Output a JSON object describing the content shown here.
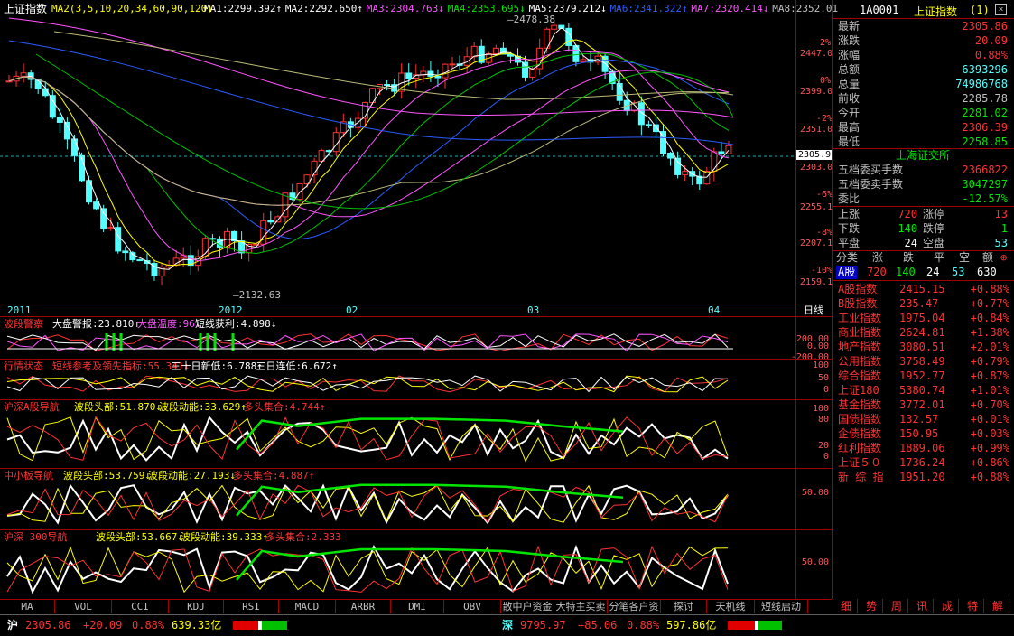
{
  "main": {
    "title": "上证指数",
    "ma_params": "MA2(3,5,10,20,34,60,90,120)",
    "ma_values": [
      {
        "label": "MA1:2299.392↑",
        "color": "#ffffff"
      },
      {
        "label": "MA2:2292.650↑",
        "color": "#ffffff"
      },
      {
        "label": "MA3:2304.763↓",
        "color": "#ff54ff"
      },
      {
        "label": "MA4:2353.695↓",
        "color": "#00e600"
      },
      {
        "label": "MA5:2379.212↓",
        "color": "#ffffff"
      },
      {
        "label": "MA6:2341.322↑",
        "color": "#2a5cff"
      },
      {
        "label": "MA7:2320.414↓",
        "color": "#ff54ff"
      },
      {
        "label": "MA8:2352.01",
        "color": "#c0c0c0"
      }
    ],
    "high_marker": "2478.38",
    "low_marker": "2132.63",
    "last_price_tag": "2305.9",
    "y_labels": [
      "2447.0",
      "2399.0",
      "2351.0",
      "2303.0",
      "2255.1",
      "2207.1",
      "2159.1"
    ],
    "pct_labels": [
      "2%",
      "0%",
      "-2%",
      "-4%",
      "-6%",
      "-8%",
      "-10%"
    ],
    "x_labels": [
      "2011",
      "2012",
      "02",
      "03",
      "04"
    ],
    "period": "日线"
  },
  "indicators": [
    {
      "name": "波段警察",
      "items": [
        {
          "label": "大盘警报:23.810↑",
          "color": "#ffffff"
        },
        {
          "label": "大盘温度:96↓",
          "color": "#ff54ff"
        },
        {
          "label": "短线获利:4.898↓",
          "color": "#ffffff"
        }
      ],
      "y_labels": [
        "200.00",
        "0.00",
        "-200.00"
      ]
    },
    {
      "name": "行情状态",
      "items": [
        {
          "label": "短线参考及领先指标:55.341↓",
          "color": "#ff3232"
        },
        {
          "label": "三十日新低:6.788↑",
          "color": "#ffffff"
        },
        {
          "label": "三日连低:6.672↑",
          "color": "#ffffff"
        }
      ],
      "y_labels": [
        "100",
        "50",
        "0"
      ]
    },
    {
      "name": "沪深A股导航",
      "items": [
        {
          "label": "波段头部:51.870↓",
          "color": "#ffff00"
        },
        {
          "label": "波段动能:33.629↑",
          "color": "#ffff00"
        },
        {
          "label": "多头集合:4.744↑",
          "color": "#ff3232"
        }
      ],
      "y_labels": [
        "100",
        "80",
        "20",
        "0"
      ]
    },
    {
      "name": "中小板导航",
      "items": [
        {
          "label": "波段头部:53.759↓",
          "color": "#ffff00"
        },
        {
          "label": "波段动能:27.193↓",
          "color": "#ffff00"
        },
        {
          "label": "多头集合:4.887↑",
          "color": "#ff3232"
        }
      ],
      "y_labels": [
        "50.00"
      ]
    },
    {
      "name": "沪深 300导航",
      "items": [
        {
          "label": "波段头部:53.667↓",
          "color": "#ffff00"
        },
        {
          "label": "波段动能:39.333↑",
          "color": "#ffff00"
        },
        {
          "label": "多头集合:2.333",
          "color": "#ff3232"
        }
      ],
      "y_labels": [
        "50.00"
      ]
    }
  ],
  "bottom_tabs": [
    "MA",
    "VOL",
    "CCI",
    "KDJ",
    "RSI",
    "MACD",
    "ARBR",
    "DMI",
    "OBV",
    "散中户资金",
    "大特主买卖",
    "分笔各户资",
    "探讨",
    "天机线",
    "短线启动"
  ],
  "right_panel": {
    "code": "1A0001",
    "name": "上证指数",
    "suffix": "(1)",
    "quote": [
      {
        "k": "最新",
        "v": "2305.86",
        "c": "#ff3232"
      },
      {
        "k": "涨跌",
        "v": "20.09",
        "c": "#ff3232"
      },
      {
        "k": "涨幅",
        "v": "0.88%",
        "c": "#ff3232"
      },
      {
        "k": "总额",
        "v": "6393296",
        "c": "#54ffff"
      },
      {
        "k": "总量",
        "v": "74986768",
        "c": "#54ffff"
      },
      {
        "k": "前收",
        "v": "2285.78",
        "c": "#c0c0c0"
      },
      {
        "k": "今开",
        "v": "2281.02",
        "c": "#00e600"
      },
      {
        "k": "最高",
        "v": "2306.39",
        "c": "#ff3232"
      },
      {
        "k": "最低",
        "v": "2258.85",
        "c": "#00e600"
      }
    ],
    "exchange": "上海证交所",
    "orders": [
      {
        "k": "五档委买手数",
        "v": "2366822",
        "c": "#ff3232"
      },
      {
        "k": "五档委卖手数",
        "v": "3047297",
        "c": "#00e600"
      },
      {
        "k": "委比",
        "v": "-12.57%",
        "c": "#00e600"
      }
    ],
    "breadth": [
      {
        "k1": "上涨",
        "v1": "720",
        "c1": "#ff3232",
        "k2": "涨停",
        "v2": "13",
        "c2": "#ff3232"
      },
      {
        "k1": "下跌",
        "v1": "140",
        "c1": "#00e600",
        "k2": "跌停",
        "v2": "1",
        "c2": "#00e600"
      },
      {
        "k1": "平盘",
        "v1": "24",
        "c1": "#ffffff",
        "k2": "空盘",
        "v2": "53",
        "c2": "#54ffff"
      }
    ],
    "class_header": [
      "分类",
      "涨",
      "跌",
      "平",
      "空",
      "额"
    ],
    "class_row": {
      "name": "A股",
      "up": "720",
      "down": "140",
      "flat": "24",
      "empty": "53",
      "amount": "630"
    },
    "indices": [
      {
        "name": "A股指数",
        "val": "2415.15",
        "chg": "+0.88%"
      },
      {
        "name": "B股指数",
        "val": "235.47",
        "chg": "+0.77%"
      },
      {
        "name": "工业指数",
        "val": "1975.04",
        "chg": "+0.84%"
      },
      {
        "name": "商业指数",
        "val": "2624.81",
        "chg": "+1.38%"
      },
      {
        "name": "地产指数",
        "val": "3080.51",
        "chg": "+2.01%"
      },
      {
        "name": "公用指数",
        "val": "3758.49",
        "chg": "+0.79%"
      },
      {
        "name": "综合指数",
        "val": "1952.77",
        "chg": "+0.87%"
      },
      {
        "name": "上证180",
        "val": "5380.74",
        "chg": "+1.01%"
      },
      {
        "name": "基金指数",
        "val": "3772.01",
        "chg": "+0.70%"
      },
      {
        "name": "国债指数",
        "val": "132.57",
        "chg": "+0.01%"
      },
      {
        "name": "企债指数",
        "val": "150.95",
        "chg": "+0.03%"
      },
      {
        "name": "红利指数",
        "val": "1889.06",
        "chg": "+0.99%"
      },
      {
        "name": "上证５０",
        "val": "1736.24",
        "chg": "+0.86%"
      },
      {
        "name": "新 综 指",
        "val": "1951.20",
        "chg": "+0.88%"
      }
    ],
    "bottom_tabs": [
      "细",
      "势",
      "周",
      "讯",
      "成",
      "特",
      "解"
    ]
  },
  "statusbar": {
    "sh_label": "沪",
    "sh_price": "2305.86",
    "sh_change": "+20.09",
    "sh_pct": "0.88%",
    "sh_amount": "639.33亿",
    "sz_label": "深",
    "sz_price": "9795.97",
    "sz_change": "+85.06",
    "sz_pct": "0.88%",
    "sz_amount": "597.86亿"
  }
}
